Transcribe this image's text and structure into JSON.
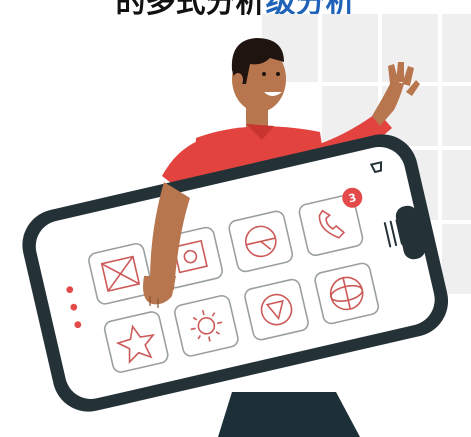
{
  "headline": {
    "part_dark": "的多式分析",
    "part_blue": "级分析"
  },
  "illustration": {
    "phone": {
      "notification_badge": "3",
      "app_icons": [
        "mail-icon",
        "image-icon",
        "compass-icon",
        "phone-icon",
        "star-icon",
        "sun-icon",
        "play-icon",
        "globe-icon"
      ]
    },
    "colors": {
      "shirt": "#e2433f",
      "skin": "#b8764f",
      "hair": "#1f1410",
      "pants": "#1e3037",
      "phone_frame": "#243238",
      "icon_stroke": "#cc5a58",
      "badge": "#e54a4a",
      "window": "#efefef"
    }
  }
}
